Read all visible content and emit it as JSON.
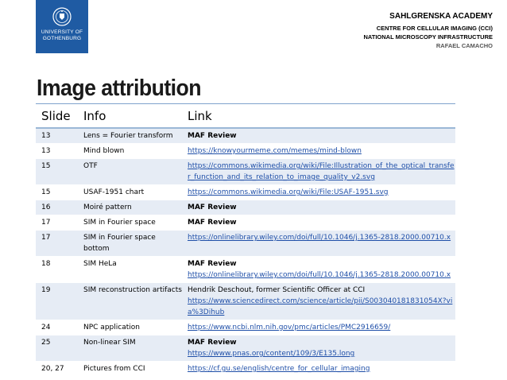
{
  "header": {
    "logo_lines": [
      "UNIVERSITY OF",
      "GOTHENBURG"
    ],
    "line1": "SAHLGRENSKA ACADEMY",
    "line2": "CENTRE FOR CELLULAR IMAGING (CCI)",
    "line3": "NATIONAL MICROSCOPY INFRASTRUCTURE",
    "line4": "RAFAEL CAMACHO"
  },
  "title": "Image attribution",
  "table": {
    "headers": [
      "Slide",
      "Info",
      "Link"
    ],
    "rows": [
      {
        "slide": "13",
        "info": "Lens = Fourier transform",
        "link_bold": "MAF Review",
        "link_text": "",
        "link_url": ""
      },
      {
        "slide": "13",
        "info": "Mind blown",
        "link_bold": "",
        "link_text": "",
        "link_url": "https://knowyourmeme.com/memes/mind-blown"
      },
      {
        "slide": "15",
        "info": "OTF",
        "link_bold": "",
        "link_text": "",
        "link_url": "https://commons.wikimedia.org/wiki/File:Illustration_of_the_optical_transfer_function_and_its_relation_to_image_quality_v2.svg"
      },
      {
        "slide": "15",
        "info": "USAF-1951 chart",
        "link_bold": "",
        "link_text": "",
        "link_url": "https://commons.wikimedia.org/wiki/File:USAF-1951.svg"
      },
      {
        "slide": "16",
        "info": "Moiré pattern",
        "link_bold": "MAF Review",
        "link_text": "",
        "link_url": ""
      },
      {
        "slide": "17",
        "info": "SIM in Fourier space",
        "link_bold": "MAF Review",
        "link_text": "",
        "link_url": ""
      },
      {
        "slide": "17",
        "info": "SIM in Fourier space bottom",
        "link_bold": "",
        "link_text": "",
        "link_url": "https://onlinelibrary.wiley.com/doi/full/10.1046/j.1365-2818.2000.00710.x"
      },
      {
        "slide": "18",
        "info": "SIM HeLa",
        "link_bold": "MAF Review",
        "link_text": "",
        "link_url": "https://onlinelibrary.wiley.com/doi/full/10.1046/j.1365-2818.2000.00710.x"
      },
      {
        "slide": "19",
        "info": "SIM reconstruction artifacts",
        "link_bold": "",
        "link_text": "Hendrik Deschout, former Scientific Officer at CCI",
        "link_url": "https://www.sciencedirect.com/science/article/pii/S003040181831054X?via%3Dihub"
      },
      {
        "slide": "24",
        "info": "NPC application",
        "link_bold": "",
        "link_text": "",
        "link_url": "https://www.ncbi.nlm.nih.gov/pmc/articles/PMC2916659/"
      },
      {
        "slide": "25",
        "info": "Non-linear SIM",
        "link_bold": "MAF Review",
        "link_text": "",
        "link_url": "https://www.pnas.org/content/109/3/E135.long"
      },
      {
        "slide": "20, 27",
        "info": "Pictures from CCI",
        "link_bold": "",
        "link_text": "",
        "link_url": "https://cf.gu.se/english/centre_for_cellular_imaging"
      }
    ]
  },
  "colors": {
    "logo_bg": "#1f5ba3",
    "row_stripe": "#e6ecf5",
    "link": "#1f4fa8",
    "rule": "#9bb7d6"
  },
  "icons": {
    "logo": "university-seal-icon"
  }
}
